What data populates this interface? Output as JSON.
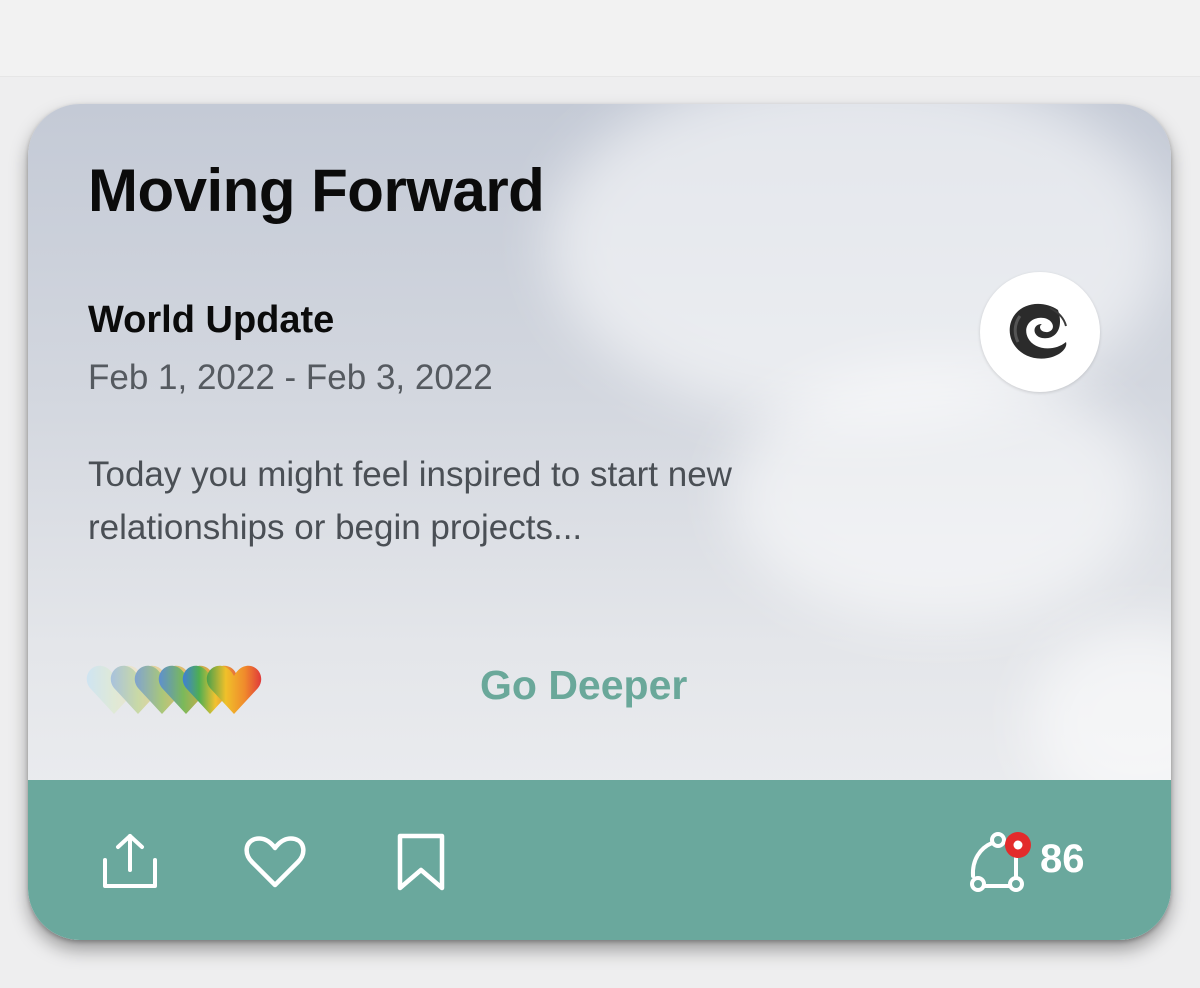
{
  "card": {
    "title": "Moving Forward",
    "subtitle": "World Update",
    "date_range": "Feb 1, 2022 - Feb 3, 2022",
    "description": "Today you might feel inspired to start new relationships or begin projects...",
    "cta_label": "Go Deeper",
    "accent_color": "#6aa89d"
  },
  "footer": {
    "actions": [
      "share-icon",
      "heart-icon",
      "bookmark-icon"
    ],
    "connections": {
      "icon": "connections-icon",
      "count": "86",
      "notification_dot_color": "#e32b2b"
    }
  }
}
